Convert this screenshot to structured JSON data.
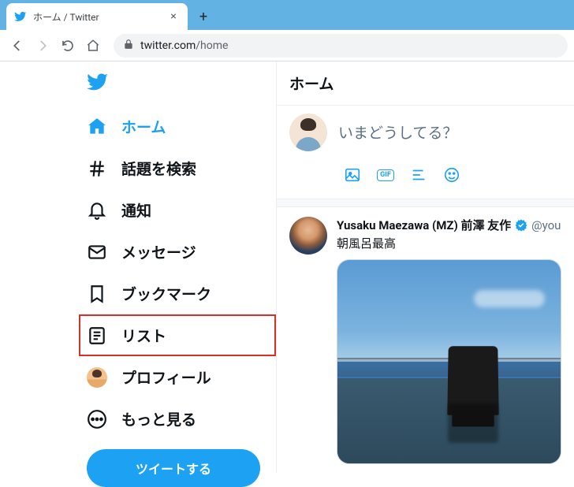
{
  "browser": {
    "tab_title": "ホーム / Twitter",
    "url_host": "twitter.com",
    "url_path": "/home"
  },
  "sidebar": {
    "items": [
      {
        "id": "home",
        "label": "ホーム"
      },
      {
        "id": "explore",
        "label": "話題を検索"
      },
      {
        "id": "notifications",
        "label": "通知"
      },
      {
        "id": "messages",
        "label": "メッセージ"
      },
      {
        "id": "bookmarks",
        "label": "ブックマーク"
      },
      {
        "id": "lists",
        "label": "リスト"
      },
      {
        "id": "profile",
        "label": "プロフィール"
      },
      {
        "id": "more",
        "label": "もっと見る"
      }
    ],
    "tweet_button": "ツイートする"
  },
  "main": {
    "header_title": "ホーム",
    "composer_placeholder": "いまどうしてる？"
  },
  "timeline": {
    "tweets": [
      {
        "display_name": "Yusaku Maezawa (MZ) 前澤 友作",
        "verified": true,
        "handle": "@you",
        "text": "朝風呂最高"
      }
    ]
  },
  "colors": {
    "accent": "#1da1f2",
    "highlight_box": "#d93025"
  }
}
